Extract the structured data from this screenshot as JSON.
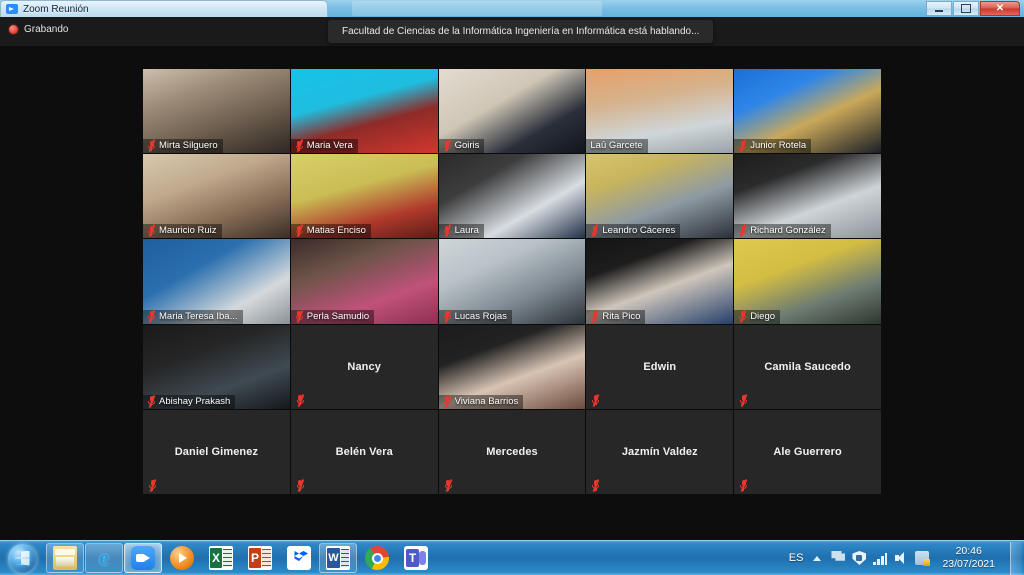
{
  "window": {
    "title": "Zoom Reunión",
    "app_icon": "zoom-icon",
    "controls": {
      "minimize": "minimize-button",
      "maximize": "maximize-button",
      "close_label": "✕"
    }
  },
  "topbar": {
    "recording_label": "Grabando",
    "recording_icon": "record-dot-icon",
    "speaker_banner": "Facultad de Ciencias de la Informática Ingeniería en Informática está hablando..."
  },
  "gallery": {
    "columns": 5,
    "rows": 5,
    "participants": [
      {
        "name": "Mirta Silguero",
        "muted": true,
        "video": true,
        "bg": "linear-gradient(160deg,#cdbfae 0%,#9d8c78 30%,#6e5f4f 62%,#2e2723 100%)"
      },
      {
        "name": "Maria Vera",
        "muted": true,
        "video": true,
        "bg": "linear-gradient(165deg,#16c3e8 0%,#1fbde0 38%,#8e2b28 62%,#d2372e 100%)"
      },
      {
        "name": "Goiris",
        "muted": true,
        "video": true,
        "bg": "linear-gradient(150deg,#e3dcd0 0%,#cfc6b6 40%,#2a2f3a 72%,#12151c 100%)"
      },
      {
        "name": "Laū Garcete",
        "muted": false,
        "video": true,
        "bg": "linear-gradient(170deg,#e8a06a 0%,#d6b28c 35%,#cfd6d9 70%,#9aa2a8 100%)"
      },
      {
        "name": "Junior Rotela",
        "muted": true,
        "video": true,
        "bg": "linear-gradient(155deg,#1b6fd6 0%,#2f86e8 30%,#caa85a 58%,#1b1f26 100%)"
      },
      {
        "name": "Mauricio Ruiz",
        "muted": true,
        "video": true,
        "bg": "linear-gradient(160deg,#d8c9ae 0%,#c0a98c 35%,#8a6f58 66%,#3a2e25 100%)"
      },
      {
        "name": "Matias Enciso",
        "muted": true,
        "video": true,
        "bg": "linear-gradient(165deg,#d9cf6b 0%,#c9bd54 40%,#b03a2c 72%,#5a1d16 100%)"
      },
      {
        "name": "Laura",
        "muted": true,
        "video": true,
        "bg": "linear-gradient(150deg,#2a2a2a 0%,#3d3d3d 30%,#d8dde2 66%,#223047 100%)"
      },
      {
        "name": "Leandro Cáceres",
        "muted": true,
        "video": true,
        "bg": "linear-gradient(160deg,#d8c56a 0%,#c7b45e 28%,#8e9aa3 60%,#2a3038 100%)"
      },
      {
        "name": "Richard González",
        "muted": true,
        "video": true,
        "bg": "linear-gradient(160deg,#1c1c1c 0%,#2b2b2b 28%,#cfd4d8 62%,#8d939a 100%)"
      },
      {
        "name": "Maria Teresa Iba...",
        "muted": true,
        "video": true,
        "bg": "linear-gradient(150deg,#1f5f9e 0%,#2a6fae 35%,#d5d9dc 72%,#8b9196 100%)"
      },
      {
        "name": "Perla Samudio",
        "muted": true,
        "video": true,
        "bg": "linear-gradient(160deg,#3a2a2a 0%,#6d5348 32%,#c0527a 68%,#8e2f52 100%)"
      },
      {
        "name": "Lucas Rojas",
        "muted": true,
        "video": true,
        "bg": "linear-gradient(155deg,#cfd6da 0%,#b9c2c8 32%,#7f8a92 64%,#2b3138 100%)"
      },
      {
        "name": "Rita Pico",
        "muted": true,
        "video": true,
        "bg": "linear-gradient(160deg,#141414 0%,#1d1d1d 28%,#cfc6bb 56%,#25406b 100%)"
      },
      {
        "name": "Diego",
        "muted": true,
        "video": true,
        "bg": "linear-gradient(160deg,#e0c94f 0%,#d4bd43 35%,#6e7c72 68%,#2e3530 100%)"
      },
      {
        "name": "Abishay Prakash",
        "muted": true,
        "video": true,
        "bg": "linear-gradient(160deg,#1a1a1a 0%,#262626 35%,#3f4a52 68%,#14181c 100%)"
      },
      {
        "name": "Nancy",
        "muted": true,
        "video": false,
        "bg": ""
      },
      {
        "name": "Viviana Barrios",
        "muted": true,
        "video": true,
        "bg": "linear-gradient(160deg,#1c1c1c 0%,#222 30%,#d8c4b4 60%,#6b4a3c 100%)"
      },
      {
        "name": "Edwin",
        "muted": true,
        "video": false,
        "bg": ""
      },
      {
        "name": "Camila Saucedo",
        "muted": true,
        "video": false,
        "bg": ""
      },
      {
        "name": "Daniel Gimenez",
        "muted": true,
        "video": false,
        "bg": ""
      },
      {
        "name": "Belén Vera",
        "muted": true,
        "video": false,
        "bg": ""
      },
      {
        "name": "Mercedes",
        "muted": true,
        "video": false,
        "bg": ""
      },
      {
        "name": "Jazmín Valdez",
        "muted": true,
        "video": false,
        "bg": ""
      },
      {
        "name": "Ale Guerrero",
        "muted": true,
        "video": false,
        "bg": ""
      }
    ]
  },
  "taskbar": {
    "start_icon": "windows-start-orb-icon",
    "items": [
      {
        "icon": "explorer-icon",
        "class": "explorer",
        "state": "pinned"
      },
      {
        "icon": "internet-explorer-icon",
        "class": "ie",
        "state": "pinned",
        "glyph": "e"
      },
      {
        "icon": "zoom-icon",
        "class": "zoom",
        "state": "active"
      },
      {
        "icon": "media-player-icon",
        "class": "wmp",
        "state": "normal"
      },
      {
        "icon": "excel-icon",
        "class": "excel",
        "state": "normal"
      },
      {
        "icon": "powerpoint-icon",
        "class": "ppt",
        "state": "normal"
      },
      {
        "icon": "dropbox-icon",
        "class": "dropbox",
        "state": "normal"
      },
      {
        "icon": "word-icon",
        "class": "word",
        "state": "pinned"
      },
      {
        "icon": "chrome-icon",
        "class": "chrome",
        "state": "normal"
      },
      {
        "icon": "teams-icon",
        "class": "teams",
        "state": "normal"
      }
    ],
    "tray": {
      "language": "ES",
      "icons": [
        "chevron-up-icon",
        "action-center-flag-icon",
        "security-shield-icon",
        "signal-bars-icon",
        "volume-icon",
        "network-icon"
      ],
      "time": "20:46",
      "date": "23/07/2021"
    }
  }
}
